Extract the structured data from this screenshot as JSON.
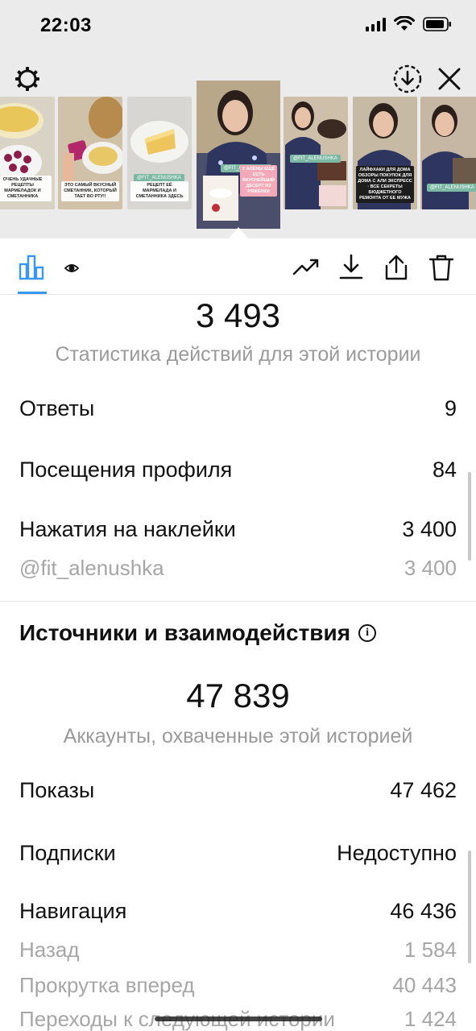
{
  "status_bar": {
    "time": "22:03"
  },
  "header": {
    "settings_icon": "gear-icon",
    "download_icon": "download-circle-icon",
    "close_icon": "close-icon"
  },
  "stories": [
    {
      "caption": "ОЧЕНЬ УДАЧНЫЕ РЕЦЕПТЫ МАРМЕЛАДОК И СМЕТАННИКА"
    },
    {
      "caption": "ЭТО САМЫЙ ВКУСНЫЙ СМЕТАННИК, КОТОРЫЙ ТАЕТ ВО РТУ!!"
    },
    {
      "tag": "@FIT_ALENUSHKA",
      "caption": "РЕЦЕПТ ЕЁ МАРМЕЛАДА И СМЕТАННИКА ЗДЕСЬ"
    },
    {
      "tag": "@FIT_ALENUSHKA",
      "caption": "У АЛЁНЫ ЕЩЁ ЕСТЬ ВКУСНЕЙШИЙ ДЕСЕРТ ИЗ РЯЖЕНКИ"
    },
    {
      "tag": "@FIT_ALENUSHKA",
      "caption": ""
    },
    {
      "caption": "ЛАЙФХАКИ ДЛЯ ДОМА ОБЗОРЫ ПОКУПОК ДЛЯ ДОМА С АЛИ ЭКСПРЕСС · ВСЕ СЕКРЕТЫ БЮДЖЕТНОГО РЕМОНТА ОТ ЕЕ МУЖА"
    },
    {
      "tag": "@FIT_ALENUSHKA",
      "caption": ""
    }
  ],
  "tabs": {
    "chart_icon": "bar-chart-icon",
    "eye_icon": "eye-icon"
  },
  "actions": [
    "trending-icon",
    "download-icon",
    "share-icon",
    "trash-icon"
  ],
  "interactions": {
    "total": "3 493",
    "caption": "Статистика действий для этой истории",
    "rows": [
      {
        "label": "Ответы",
        "value": "9"
      },
      {
        "label": "Посещения профиля",
        "value": "84"
      },
      {
        "label": "Нажатия на наклейки",
        "value": "3 400"
      }
    ],
    "sub_rows": [
      {
        "label": "@fit_alenushka",
        "value": "3 400"
      }
    ]
  },
  "discovery": {
    "title": "Источники и взаимодействия",
    "info_icon": "info-icon",
    "total": "47 839",
    "caption": "Аккаунты, охваченные этой историей",
    "rows": [
      {
        "label": "Показы",
        "value": "47 462"
      },
      {
        "label": "Подписки",
        "value": "Недоступно"
      },
      {
        "label": "Навигация",
        "value": "46 436"
      }
    ],
    "nav_rows": [
      {
        "label": "Назад",
        "value": "1 584"
      },
      {
        "label": "Прокрутка вперед",
        "value": "40 443"
      },
      {
        "label": "Переходы к следующей истории",
        "value": "1 424"
      }
    ]
  },
  "colors": {
    "accent": "#3897f0",
    "muted": "#9a9a9a",
    "topbg": "#ebebeb"
  }
}
